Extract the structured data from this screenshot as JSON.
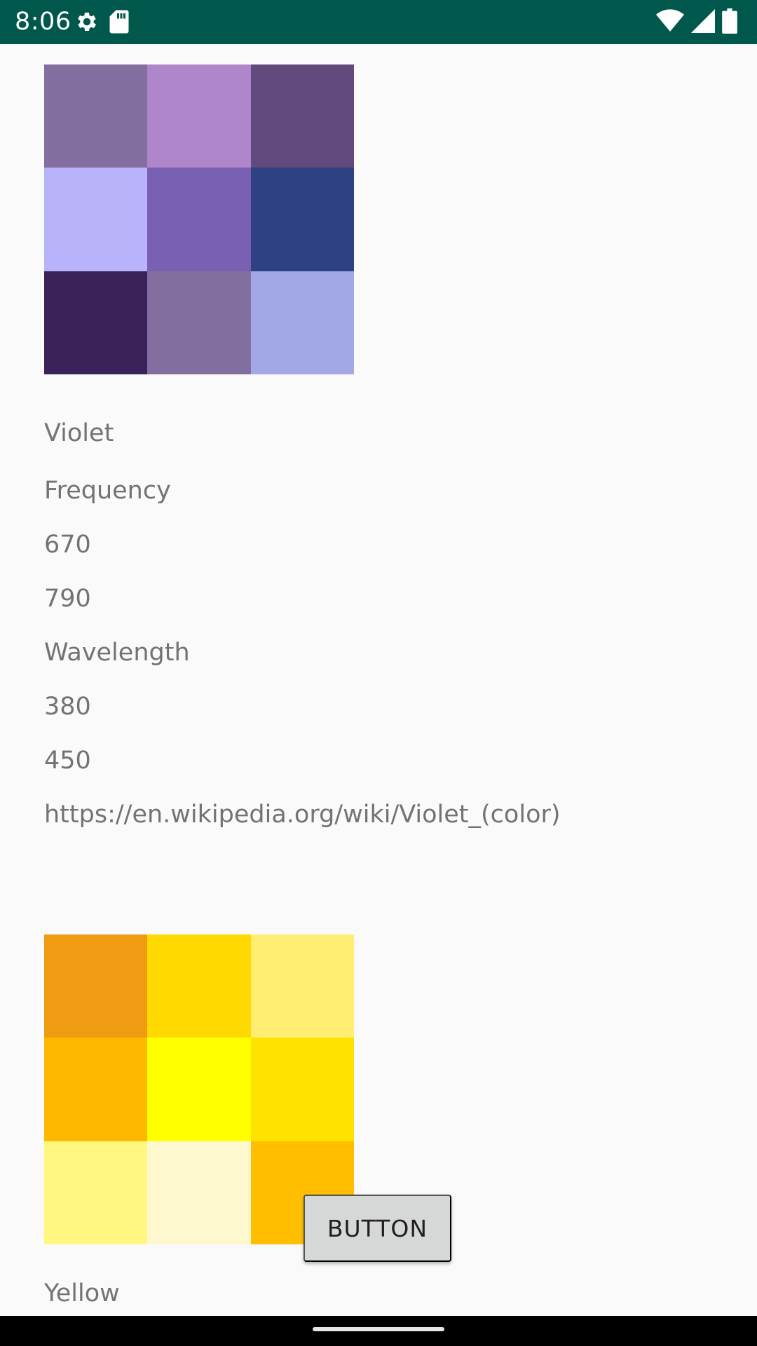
{
  "status_bar": {
    "time": "8:06",
    "background": "#00574b",
    "icons": [
      "settings-icon",
      "sd-card-icon",
      "wifi-icon",
      "cell-signal-icon",
      "battery-icon"
    ]
  },
  "cards": [
    {
      "name": "Violet",
      "swatches": [
        "#826e9f",
        "#ae86c9",
        "#62497e",
        "#b8b3fa",
        "#7a60b2",
        "#2e4283",
        "#3c225a",
        "#826e9f",
        "#a2a8e6"
      ],
      "frequency_label": "Frequency",
      "frequency_min": "670",
      "frequency_max": "790",
      "wavelength_label": "Wavelength",
      "wavelength_min": "380",
      "wavelength_max": "450",
      "url": "https://en.wikipedia.org/wiki/Violet_(color)"
    },
    {
      "name": "Yellow",
      "swatches": [
        "#ef9c13",
        "#ffd900",
        "#ffee72",
        "#ffb800",
        "#ffff00",
        "#ffe200",
        "#fff77f",
        "#fff8cf",
        "#ffbf00"
      ]
    }
  ],
  "button": {
    "label": "BUTTON"
  }
}
